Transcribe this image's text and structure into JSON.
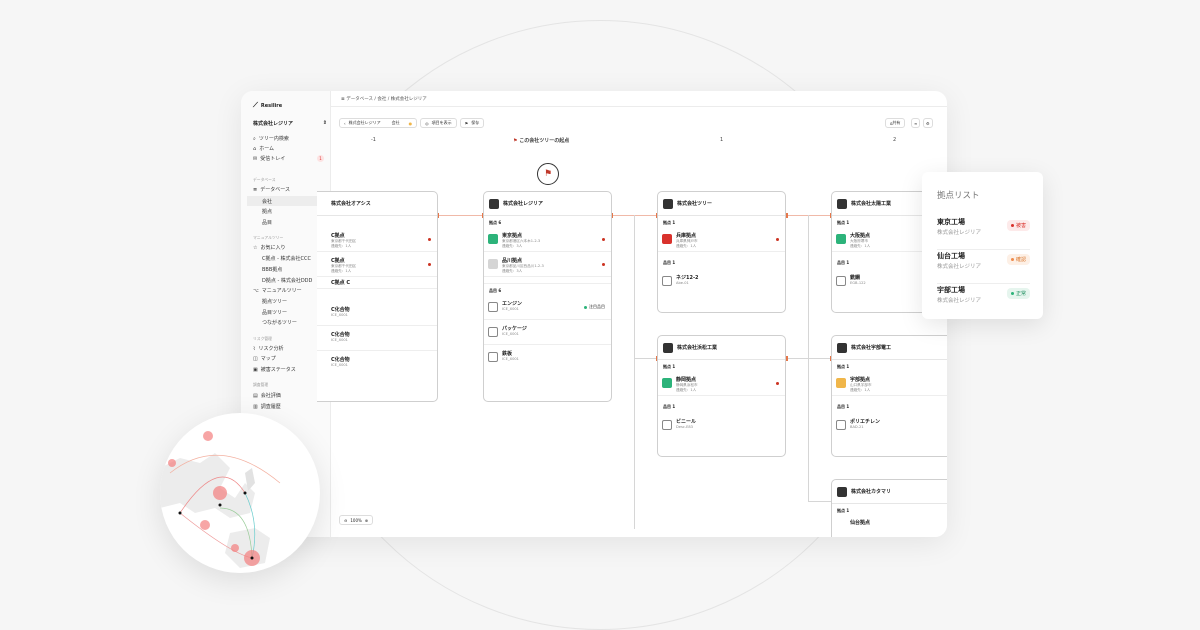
{
  "app": {
    "logo": "Resilire",
    "workspace": "株式会社レジリア",
    "breadcrumb": "データベース / 会社 / 株式会社レジリア"
  },
  "sidebar": {
    "top_items": [
      {
        "label": "ツリー内検索",
        "icon": "search-icon"
      },
      {
        "label": "ホーム",
        "icon": "home-icon"
      },
      {
        "label": "受信トレイ",
        "icon": "inbox-icon",
        "count": "1"
      }
    ],
    "db_section": "データベース",
    "db_item": "データベース",
    "db_subitems": [
      "会社",
      "拠点",
      "品目"
    ],
    "manual_section": "マニュアルツリー",
    "manual_items": [
      {
        "label": "お気に入り",
        "sub": false
      },
      {
        "label": "C拠点 - 株式会社CCC",
        "sub": true
      },
      {
        "label": "BBB拠点",
        "sub": true
      },
      {
        "label": "D拠点 - 株式会社DDD",
        "sub": true
      },
      {
        "label": "マニュアルツリー",
        "sub": false
      },
      {
        "label": "拠点ツリー",
        "sub": true
      },
      {
        "label": "品目ツリー",
        "sub": true
      },
      {
        "label": "つながるツリー",
        "sub": true
      }
    ],
    "risk_section": "リスク管理",
    "risk_items": [
      "リスク分析",
      "マップ",
      "被害ステータス"
    ],
    "survey_section": "調査管理",
    "survey_items": [
      "会社評価",
      "調査履歴"
    ]
  },
  "toolbar": {
    "company_chip": "株式会社レジリア",
    "type_chip": "会社",
    "view_button": "項目を表示",
    "bookmark_button": "保存",
    "share_button": "共有"
  },
  "columns": {
    "minus1": "-1",
    "origin": "この会社ツリーの起点",
    "plus1": "1",
    "plus2": "2"
  },
  "cards": {
    "oasis": {
      "title": "株式会社オアシス",
      "rows": [
        {
          "title": "C拠点",
          "sub1": "東京都千代田区",
          "sub2": "連絡先：1人"
        },
        {
          "title": "C拠点",
          "sub1": "東京都千代田区",
          "sub2": "連絡先：1人"
        },
        {
          "title": "C拠点 C",
          "sub1": "",
          "sub2": ""
        },
        {
          "title": "C化合物",
          "sub1": "ICE_X001",
          "sub2": ""
        },
        {
          "title": "C化合物",
          "sub1": "ICE_X001",
          "sub2": ""
        },
        {
          "title": "C化合物",
          "sub1": "ICE_X001",
          "sub2": ""
        }
      ]
    },
    "resilire": {
      "title": "株式会社レジリア",
      "site_label": "拠点 6",
      "item_label": "品目 6",
      "sites": [
        {
          "title": "東京拠点",
          "sub1": "東京都港区六本木1-2-3",
          "sub2": "連絡先：3人"
        },
        {
          "title": "品川拠点",
          "sub1": "東京都品川区西品川1-2-3",
          "sub2": "連絡先：3人"
        }
      ],
      "items": [
        {
          "title": "エンジン",
          "sub1": "ICE_X001",
          "tag": "注目品目"
        },
        {
          "title": "パッケージ",
          "sub1": "ICE_X001"
        },
        {
          "title": "鉄板",
          "sub1": "ICE_X001"
        }
      ]
    },
    "tree": {
      "title": "株式会社ツリー",
      "site_label": "拠点 1",
      "item_label": "品目 1",
      "site": {
        "title": "兵庫拠点",
        "sub1": "兵庫県神戸市",
        "sub2": "連絡先：1人"
      },
      "item": {
        "title": "ネジ12-2",
        "sub1": "Abe-01"
      }
    },
    "hamamatsu": {
      "title": "株式会社浜松工業",
      "site_label": "拠点 1",
      "item_label": "品目 1",
      "site": {
        "title": "静岡拠点",
        "sub1": "静岡県浜松市",
        "sub2": "連絡先：1人"
      },
      "item": {
        "title": "ビニール",
        "sub1": "Desc-E83"
      }
    },
    "taiyo": {
      "title": "株式会社太陽工業",
      "site_label": "拠点 1",
      "item_label": "品目 1",
      "site": {
        "title": "大阪拠点",
        "sub1": "大阪府堺市",
        "sub2": "連絡先：1人"
      },
      "item": {
        "title": "銑鋼",
        "sub1": "EGB-122"
      }
    },
    "ube": {
      "title": "株式会社宇部電工",
      "site_label": "拠点 1",
      "item_label": "品目 1",
      "site": {
        "title": "宇部拠点",
        "sub1": "山口県宇部市",
        "sub2": "連絡先：1人"
      },
      "item": {
        "title": "ポリエチレン",
        "sub1": "BAD-21"
      }
    },
    "katamari": {
      "title": "株式会社カタマリ",
      "site_label": "拠点 1",
      "site_title": "仙台拠点"
    }
  },
  "zoom": "100%",
  "panel": {
    "title": "拠点リスト",
    "rows": [
      {
        "name": "東京工場",
        "company": "株式会社レジリア",
        "status": "被害",
        "color": "#d9322c",
        "bg": "#fdeaea"
      },
      {
        "name": "仙台工場",
        "company": "株式会社レジリア",
        "status": "確認",
        "color": "#f08a4b",
        "bg": "#fdf0e6"
      },
      {
        "name": "宇部工場",
        "company": "株式会社レジリア",
        "status": "正常",
        "color": "#2cb37a",
        "bg": "#e6f5ee"
      }
    ]
  }
}
